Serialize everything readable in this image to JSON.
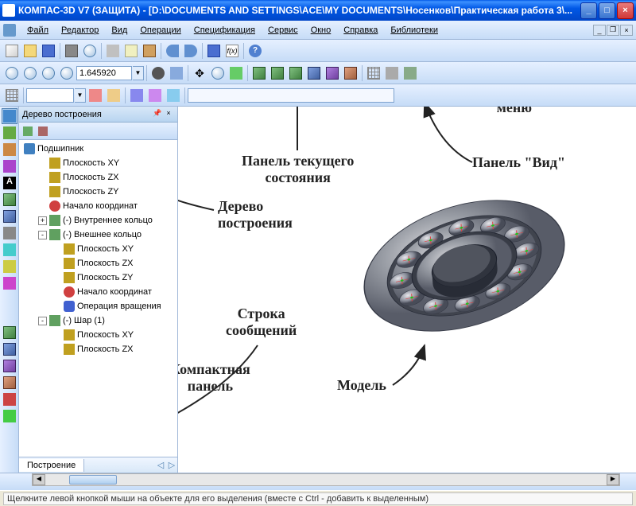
{
  "title": "КОМПАС-3D V7 (ЗАЩИТА) - [D:\\DOCUMENTS AND SETTINGS\\ACE\\MY DOCUMENTS\\Носенков\\Практическая работа 3\\...",
  "menu": [
    "Файл",
    "Редактор",
    "Вид",
    "Операции",
    "Спецификация",
    "Сервис",
    "Окно",
    "Справка",
    "Библиотеки"
  ],
  "toolbar2": {
    "zoom_value": "1.645920"
  },
  "tree": {
    "title": "Дерево построения",
    "root": "Подшипник",
    "nodes": [
      {
        "label": "Плоскость XY",
        "icon": "plane",
        "indent": 1
      },
      {
        "label": "Плоскость ZX",
        "icon": "plane",
        "indent": 1
      },
      {
        "label": "Плоскость ZY",
        "icon": "plane",
        "indent": 1
      },
      {
        "label": "Начало координат",
        "icon": "axis",
        "indent": 1
      },
      {
        "label": "(-) Внутреннее кольцо",
        "icon": "body",
        "indent": 1,
        "exp": "+"
      },
      {
        "label": "(-) Внешнее кольцо",
        "icon": "body",
        "indent": 1,
        "exp": "-"
      },
      {
        "label": "Плоскость XY",
        "icon": "plane",
        "indent": 2
      },
      {
        "label": "Плоскость ZX",
        "icon": "plane",
        "indent": 2
      },
      {
        "label": "Плоскость ZY",
        "icon": "plane",
        "indent": 2
      },
      {
        "label": "Начало координат",
        "icon": "axis",
        "indent": 2
      },
      {
        "label": "Операция вращения",
        "icon": "op",
        "indent": 2
      },
      {
        "label": "(-) Шар (1)",
        "icon": "body",
        "indent": 1,
        "exp": "-"
      },
      {
        "label": "Плоскость XY",
        "icon": "plane",
        "indent": 2
      },
      {
        "label": "Плоскость ZX",
        "icon": "plane",
        "indent": 2
      }
    ],
    "tab": "Построение"
  },
  "annotations": {
    "main_menu": "Главное\nменю",
    "view_panel": "Панель \"Вид\"",
    "state_panel": "Панель текущего\nсостояния",
    "build_tree": "Дерево\nпостроения",
    "msg_line": "Строка\nсообщений",
    "compact": "Компактная\nпанель",
    "model": "Модель"
  },
  "statusbar": "Щелкните левой кнопкой мыши на объекте для его выделения (вместе с Ctrl - добавить к выделенным)"
}
